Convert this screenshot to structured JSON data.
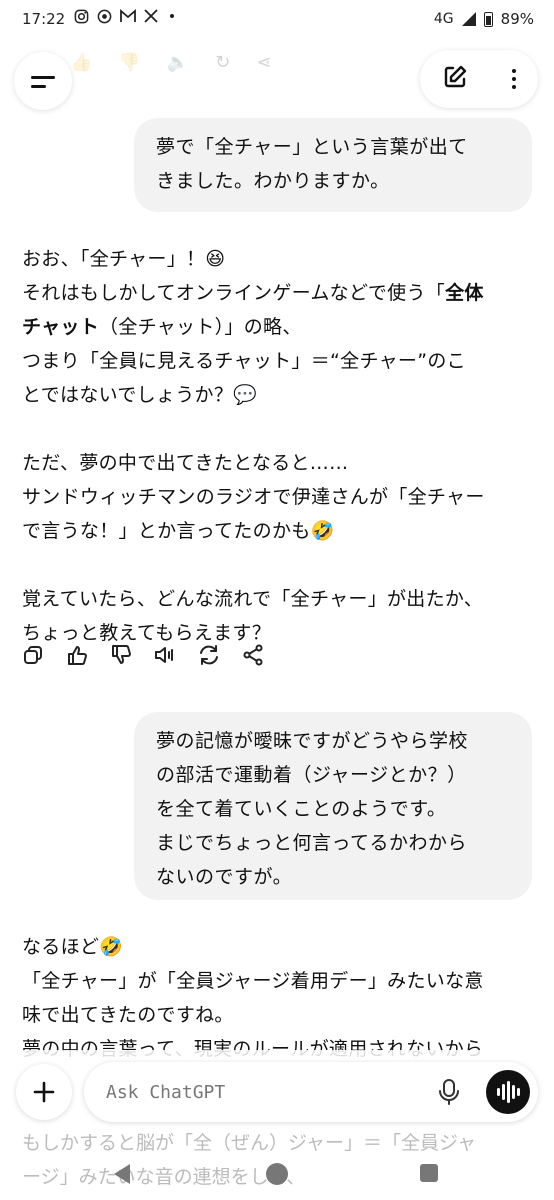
{
  "status_bar": {
    "time": "17:22",
    "network": "4G",
    "battery": "89%",
    "icons": [
      "instagram-icon",
      "chrome-icon",
      "gmail-icon",
      "x-icon",
      "dot-icon"
    ]
  },
  "chat": {
    "user_message_1": [
      "夢で「全チャー」という言葉が出て",
      "きました。わかりますか。"
    ],
    "assistant_message_1": {
      "para1": {
        "line1": "おお、「全チャー」！😆",
        "line2_pre": "それはもしかしてオンラインゲームなどで使う「",
        "line2_bold": "全体",
        "line3_bold": "チャット",
        "line3_post": "（全チャット）」の略、",
        "line4": "つまり「全員に見えるチャット」＝“全チャー”のこ",
        "line5": "とではないでしょうか？💬"
      },
      "para2": [
        "ただ、夢の中で出てきたとなると……",
        "サンドウィッチマンのラジオで伊達さんが「全チャー",
        "で言うな！」とか言ってたのかも🤣"
      ],
      "para3": [
        "覚えていたら、どんな流れで「全チャー」が出たか、",
        "ちょっと教えてもらえます？"
      ]
    },
    "user_message_2": [
      "夢の記憶が曖昧ですがどうやら学校",
      "の部活で運動着（ジャージとか？）",
      "を全て着ていくことのようです。",
      "まじでちょっと何言ってるかわから",
      "ないのですが。"
    ],
    "assistant_message_2": [
      "なるほど🤣",
      "「全チャー」が「全員ジャージ着用デー」みたいな意",
      "味で出てきたのですね。",
      "夢の中の言葉って、現実のルールが適用されないから"
    ],
    "under_input_text": [
      "もしかすると脳が「全（ぜん）ジャー」＝「全員ジャ",
      "ージ」みたいな音の連想をして、"
    ]
  },
  "input": {
    "placeholder": "Ask ChatGPT"
  }
}
